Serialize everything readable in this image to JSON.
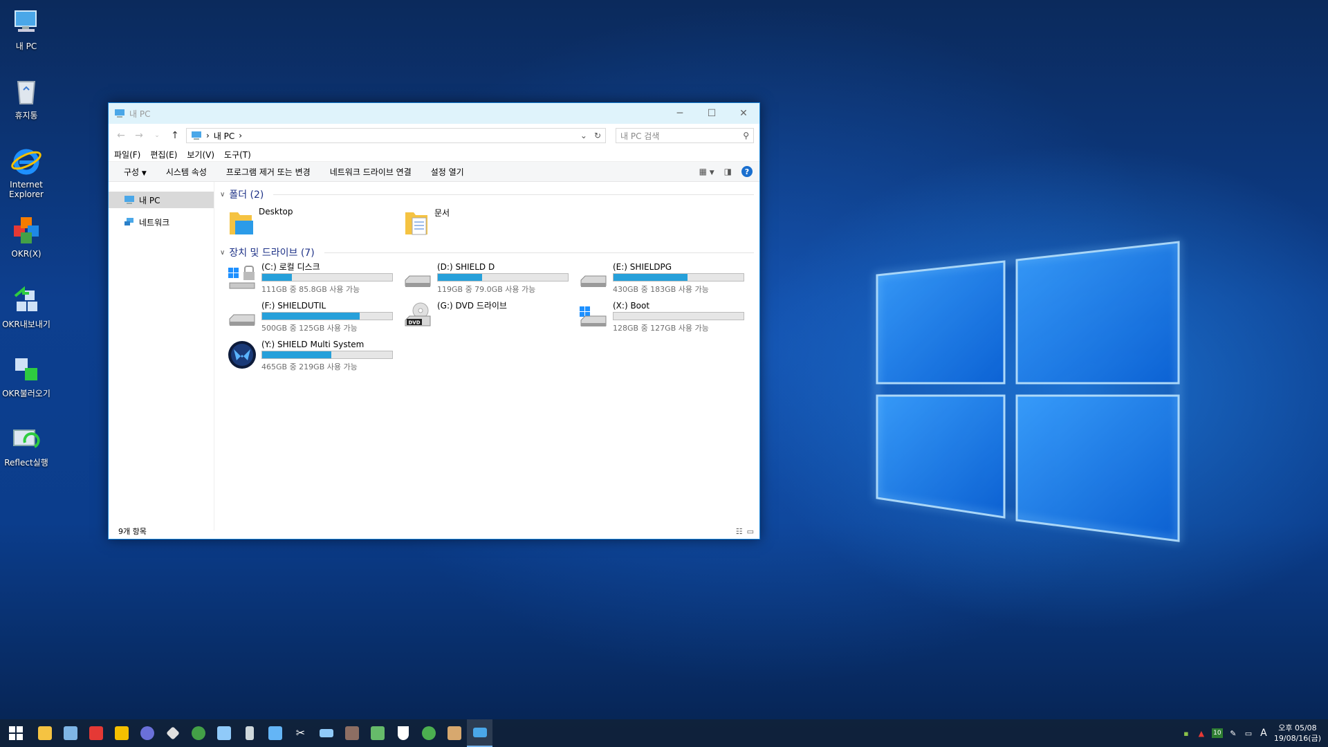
{
  "desktop": {
    "icons": [
      {
        "label": "내 PC"
      },
      {
        "label": "휴지통"
      },
      {
        "label": "Internet Explorer"
      },
      {
        "label": "OKR(X)"
      },
      {
        "label": "OKR내보내기"
      },
      {
        "label": "OKR불러오기"
      },
      {
        "label": "Reflect실행"
      }
    ]
  },
  "window": {
    "title": "내 PC",
    "address": {
      "crumb": "내 PC",
      "separator": "›"
    },
    "search_placeholder": "내 PC 검색",
    "menu": [
      "파일(F)",
      "편집(E)",
      "보기(V)",
      "도구(T)"
    ],
    "toolbar": {
      "organize": "구성",
      "system_properties": "시스템 속성",
      "uninstall": "프로그램 제거 또는 변경",
      "map_drive": "네트워크 드라이브 연결",
      "open_settings": "설정 열기",
      "help": "?"
    },
    "nav": [
      {
        "label": "내 PC"
      },
      {
        "label": "네트워크"
      }
    ],
    "folders_header": "폴더 (2)",
    "folders": [
      {
        "name": "Desktop"
      },
      {
        "name": "문서"
      }
    ],
    "drives_header": "장치 및 드라이브 (7)",
    "drives": [
      {
        "name": "(C:) 로컬 디스크",
        "space": "111GB 중 85.8GB 사용 가능",
        "used_fraction": 0.23,
        "icon": "windows-drive-icon"
      },
      {
        "name": "(D:) SHIELD D",
        "space": "119GB 중 79.0GB 사용 가능",
        "used_fraction": 0.34,
        "icon": "hard-drive-icon"
      },
      {
        "name": "(E:) SHIELDPG",
        "space": "430GB 중 183GB 사용 가능",
        "used_fraction": 0.57,
        "icon": "hard-drive-icon"
      },
      {
        "name": "(F:) SHIELDUTIL",
        "space": "500GB 중 125GB 사용 가능",
        "used_fraction": 0.75,
        "icon": "hard-drive-icon"
      },
      {
        "name": "(G:) DVD 드라이브",
        "space": "",
        "used_fraction": null,
        "icon": "dvd-drive-icon"
      },
      {
        "name": "(X:) Boot",
        "space": "128GB 중 127GB 사용 가능",
        "used_fraction": 0.0,
        "icon": "windows-drive-icon"
      },
      {
        "name": "(Y:) SHIELD Multi System",
        "space": "465GB 중 219GB 사용 가능",
        "used_fraction": 0.53,
        "icon": "shield-drive-icon"
      }
    ],
    "status": "9개 항목",
    "dvd_label": "DVD"
  },
  "taskbar": {
    "clock_time": "오후 05/08",
    "clock_date": "19/08/16(금)",
    "tray_number": "10",
    "ime": "A"
  },
  "colors": {
    "accent": "#1883d7",
    "progress": "#26a0da",
    "header_text": "#1e3287"
  }
}
